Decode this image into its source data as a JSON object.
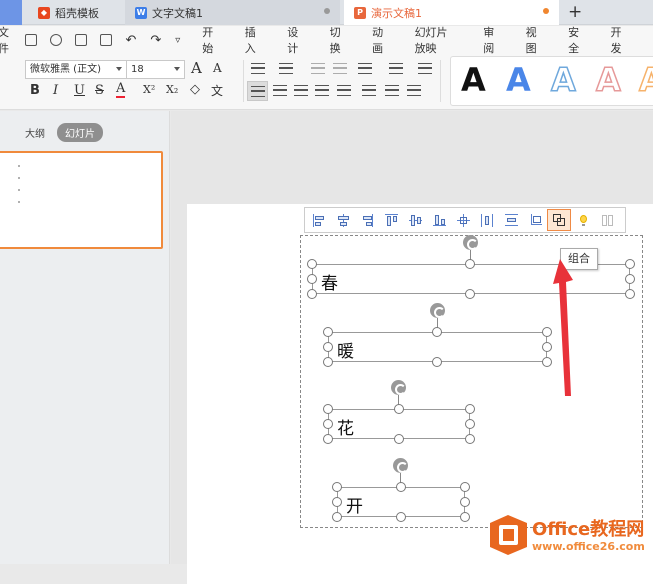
{
  "tabs": [
    {
      "label": ""
    },
    {
      "label": "稻壳模板"
    },
    {
      "label": "文字文稿1"
    },
    {
      "label": "演示文稿1"
    }
  ],
  "tab_add": "+",
  "menu": {
    "file": "文件",
    "items": [
      "开始",
      "插入",
      "设计",
      "切换",
      "动画",
      "幻灯片放映",
      "审阅",
      "视图",
      "安全",
      "开发"
    ]
  },
  "ribbon": {
    "font_name": "微软雅黑 (正文)",
    "font_size": "18",
    "bold": "B",
    "italic": "I",
    "underline": "U",
    "strike": "S",
    "color_a": "A",
    "superscript": "X²",
    "subscript": "X₂",
    "grow_font": "A",
    "shrink_font": "A",
    "style_letters": [
      "A",
      "A",
      "A",
      "A",
      "A"
    ],
    "style_colors": [
      "#111111",
      "#4a86e8",
      "#6fa8dc",
      "#e69999",
      "#f6b26b"
    ]
  },
  "left_panel": {
    "tab_outline": "大纲",
    "tab_slides": "幻灯片"
  },
  "slide": {
    "boxes": [
      {
        "text": "春"
      },
      {
        "text": "暖"
      },
      {
        "text": "花"
      },
      {
        "text": "开"
      }
    ]
  },
  "float_toolbar": {
    "active_tooltip": "组合"
  },
  "watermark": {
    "title": "Office教程网",
    "url": "www.office26.com"
  },
  "colors": {
    "accent": "#f08a3c",
    "arrow": "#e8323a",
    "selection_blue": "#5b82cf"
  }
}
